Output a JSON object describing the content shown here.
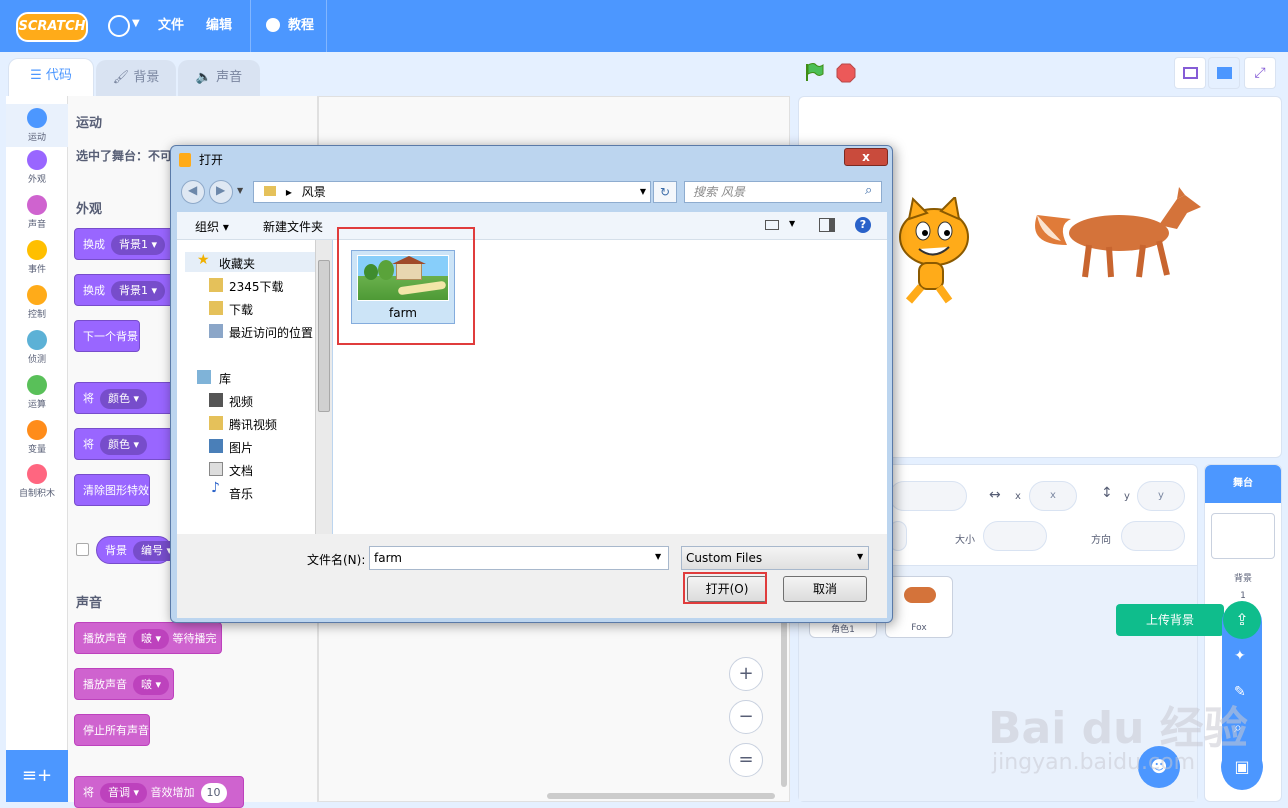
{
  "menubar": {
    "logo": "SCRATCH",
    "file": "文件",
    "edit": "编辑",
    "tutorials": "教程"
  },
  "tabs": [
    {
      "label": "代码"
    },
    {
      "label": "背景"
    },
    {
      "label": "声音"
    }
  ],
  "categories": [
    {
      "label": "运动",
      "color": "#4c97ff"
    },
    {
      "label": "外观",
      "color": "#9966ff"
    },
    {
      "label": "声音",
      "color": "#cf63cf"
    },
    {
      "label": "事件",
      "color": "#ffbf00"
    },
    {
      "label": "控制",
      "color": "#ffab19"
    },
    {
      "label": "侦测",
      "color": "#5cb1d6"
    },
    {
      "label": "运算",
      "color": "#59c059"
    },
    {
      "label": "变量",
      "color": "#ff8c1a"
    },
    {
      "label": "自制积木",
      "color": "#ff6680"
    }
  ],
  "palette": {
    "motion_title": "运动",
    "motion_note": "选中了舞台：不可",
    "looks_title": "外观",
    "sound_title": "声音",
    "blocks": {
      "switch1": "换成",
      "switch1_val": "背景1 ▾",
      "switch2": "换成",
      "switch2_val": "背景1 ▾",
      "next": "下一个背景",
      "set_effect": "将",
      "set_effect_val": "颜色 ▾",
      "change_effect": "将",
      "change_effect_val": "颜色 ▾",
      "clear_effects": "清除图形特效",
      "backdrop": "背景",
      "backdrop_val": "编号 ▾",
      "play_until": "播放声音",
      "play_until_val": "啵 ▾",
      "play_until_tail": "等待播完",
      "play": "播放声音",
      "play_val": "啵 ▾",
      "stop_all": "停止所有声音",
      "set_sound": "将",
      "set_sound_val": "音调 ▾",
      "set_sound_tail": "音效增加",
      "set_sound_num": "10"
    }
  },
  "zoom": {
    "in": "+",
    "out": "−",
    "reset": "="
  },
  "sprite_info": {
    "x_label": "x",
    "x_value": "x",
    "y_label": "y",
    "y_value": "y",
    "size_label": "大小",
    "direction_label": "方向"
  },
  "sprites": [
    {
      "name": "角色1"
    },
    {
      "name": "Fox"
    }
  ],
  "stage_pane": {
    "header": "舞台",
    "backdrops_label": "背景",
    "backdrops_count": "1",
    "upload_tip": "上传背景"
  },
  "dialog": {
    "title": "打开",
    "close": "x",
    "address": "风景",
    "search_placeholder": "搜索 风景",
    "organize": "组织 ▾",
    "new_folder": "新建文件夹",
    "tree": {
      "favorites": "收藏夹",
      "f1": "2345下载",
      "f2": "下载",
      "f3": "最近访问的位置",
      "library": "库",
      "l1": "视频",
      "l2": "腾讯视频",
      "l3": "图片",
      "l4": "文档",
      "l5": "音乐"
    },
    "file": {
      "name": "farm"
    },
    "filename_label": "文件名(N):",
    "filename_value": "farm",
    "filetype": "Custom Files",
    "open": "打开(O)",
    "cancel": "取消"
  },
  "watermark": {
    "line1": "Bai du 经验",
    "line2": "jingyan.baidu.com"
  }
}
